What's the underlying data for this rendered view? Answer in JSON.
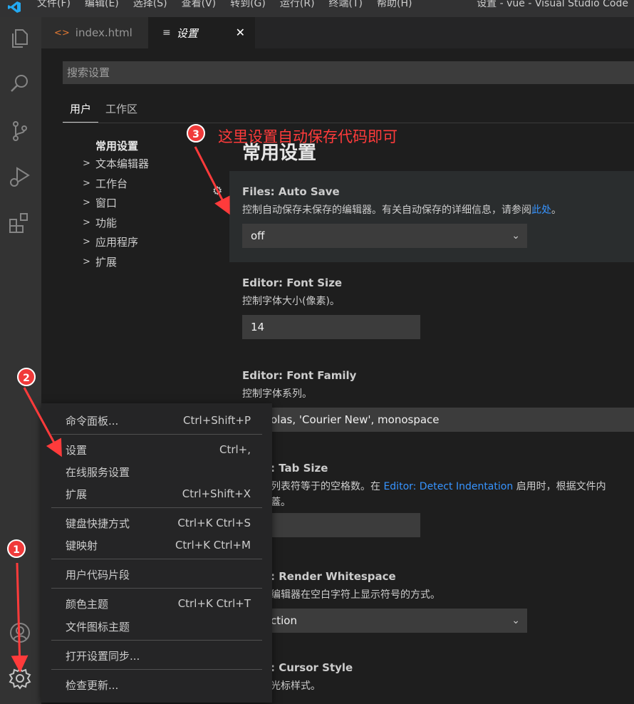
{
  "titlebar": {
    "menus": [
      "文件(F)",
      "编辑(E)",
      "选择(S)",
      "查看(V)",
      "转到(G)",
      "运行(R)",
      "终端(T)",
      "帮助(H)"
    ],
    "window_title": "设置 - vue - Visual Studio Code"
  },
  "tabs": [
    {
      "label": "index.html",
      "icon": "html-file-icon"
    },
    {
      "label": "设置",
      "icon": "settings-file-icon",
      "close": "✕"
    }
  ],
  "search": {
    "placeholder": "搜索设置"
  },
  "scope": {
    "user": "用户",
    "workspace": "工作区"
  },
  "toc": {
    "head": "常用设置",
    "items": [
      "文本编辑器",
      "工作台",
      "窗口",
      "功能",
      "应用程序",
      "扩展"
    ]
  },
  "section_title": "常用设置",
  "settings": {
    "autosave": {
      "cat": "Files: ",
      "name": "Auto Save",
      "desc": "控制自动保存未保存的编辑器。有关自动保存的详细信息，请参阅",
      "link": "此处",
      "desc_end": "。",
      "value": "off"
    },
    "fontsize": {
      "cat": "Editor: ",
      "name": "Font Size",
      "desc": "控制字体大小(像素)。",
      "value": "14"
    },
    "fontfamily": {
      "cat": "Editor: ",
      "name": "Font Family",
      "desc": "控制字体系列。",
      "value": "olas, 'Courier New', monospace"
    },
    "tabsize": {
      "name": ": Tab Size",
      "desc_start": "列表符等于的空格数。在 ",
      "link": "Editor: Detect Indentation",
      "desc_end": " 启用时，根据文件内",
      "desc2": "蓋。"
    },
    "whitespace": {
      "name": ": Render Whitespace",
      "desc": "编辑器在空白字符上显示符号的方式。",
      "value": "ction"
    },
    "cursor": {
      "name": ": Cursor Style",
      "desc": "光标样式。"
    }
  },
  "context_menu": {
    "items": [
      {
        "label": "命令面板...",
        "kb": "Ctrl+Shift+P"
      },
      {
        "label": "设置",
        "kb": "Ctrl+,"
      },
      {
        "label": "在线服务设置",
        "kb": ""
      },
      {
        "label": "扩展",
        "kb": "Ctrl+Shift+X"
      },
      {
        "label": "键盘快捷方式",
        "kb": "Ctrl+K Ctrl+S"
      },
      {
        "label": "键映射",
        "kb": "Ctrl+K Ctrl+M"
      },
      {
        "label": "用户代码片段",
        "kb": ""
      },
      {
        "label": "颜色主题",
        "kb": "Ctrl+K Ctrl+T"
      },
      {
        "label": "文件图标主题",
        "kb": ""
      },
      {
        "label": "打开设置同步...",
        "kb": ""
      },
      {
        "label": "检查更新...",
        "kb": ""
      }
    ]
  },
  "annotations": {
    "badge1": "1",
    "badge2": "2",
    "badge3": "3",
    "note": "这里设置自动保存代码即可",
    "color": "#ff3b3b"
  }
}
